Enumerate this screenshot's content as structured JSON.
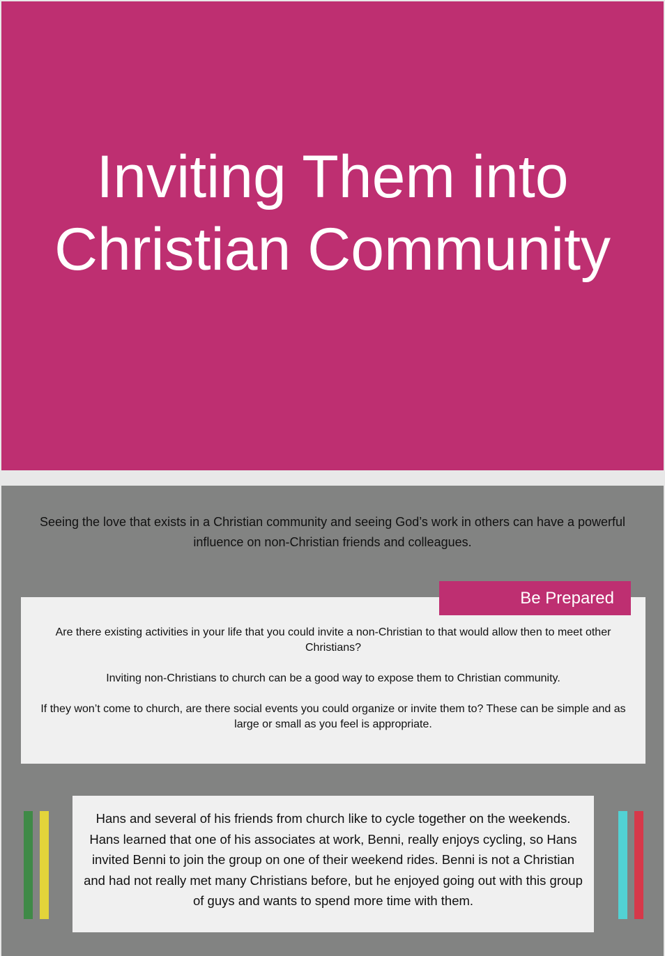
{
  "hero": {
    "title": "Inviting Them into Christian Community",
    "background_color": "#be2f71"
  },
  "intro": {
    "text": "Seeing the love that exists in a Christian community and seeing God’s work in others can have a powerful influence on non-Christian friends and colleagues."
  },
  "prepared": {
    "label": "Be Prepared",
    "paragraphs": [
      "Are there existing activities in your life that you could invite a non-Christian to that would allow then to meet other Christians?",
      "Inviting non-Christians to church can be a good way to expose them to Christian community.",
      "If they won’t come to church, are there social events you could organize or invite them to? These can be simple and as large or small as you feel is appropriate."
    ]
  },
  "story": {
    "text": "Hans and several of his friends from church like to cycle together on the weekends. Hans learned that one of his associates at work, Benni, really enjoys cycling, so Hans invited Benni to join the group on one of their weekend rides. Benni is not a Christian and had not really met many Christians before, but he enjoyed going out with this group of guys and wants to spend more time with them."
  },
  "decor": {
    "left_bar_colors": [
      "#3f8a47",
      "#e3d43a"
    ],
    "right_bar_colors": [
      "#52d2d4",
      "#d6394a"
    ],
    "panel_color": "#828382"
  }
}
